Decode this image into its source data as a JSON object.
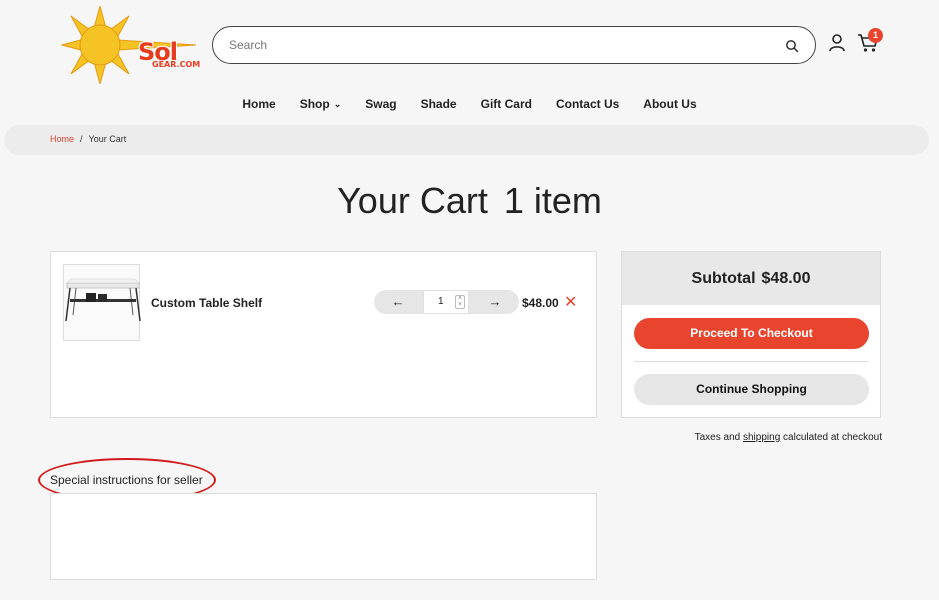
{
  "brand": {
    "logo_text": "Sol",
    "logo_sub": "GEAR.COM",
    "accent_color": "#e9452e",
    "sun_color": "#f6c324"
  },
  "header": {
    "search_placeholder": "Search",
    "cart_count": "1",
    "icons": [
      "search-icon",
      "user-icon",
      "cart-icon"
    ]
  },
  "nav": {
    "items": [
      "Home",
      "Shop",
      "Swag",
      "Shade",
      "Gift Card",
      "Contact Us",
      "About Us"
    ]
  },
  "breadcrumb": {
    "home": "Home",
    "separator": "/",
    "current": "Your Cart"
  },
  "page": {
    "title": "Your Cart",
    "count_label": "1 item"
  },
  "cart": {
    "item_name": "Custom Table Shelf",
    "quantity": "1",
    "price": "$48.00",
    "minus_icon": "arrow-left-icon",
    "plus_icon": "arrow-right-icon",
    "remove_icon": "close-icon"
  },
  "summary": {
    "subtotal_label": "Subtotal",
    "subtotal_value": "$48.00",
    "checkout_label": "Proceed To Checkout",
    "continue_label": "Continue Shopping"
  },
  "tax_note": {
    "prefix": "Taxes and",
    "link": "shipping",
    "suffix": "calculated at checkout"
  },
  "instructions": {
    "label": "Special instructions for seller",
    "value": ""
  }
}
